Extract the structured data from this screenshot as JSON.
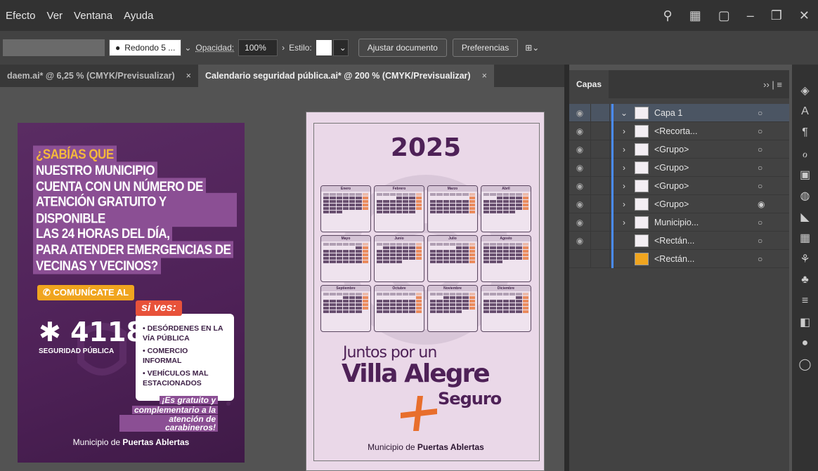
{
  "menu": [
    "Efecto",
    "Ver",
    "Ventana",
    "Ayuda"
  ],
  "window_icons": [
    "search-icon",
    "arrange-icon",
    "screen-mode-icon",
    "minimize-icon",
    "restore-icon",
    "close-icon"
  ],
  "control_bar": {
    "brush": "Redondo 5 ...",
    "opacity_label": "Opacidad:",
    "opacity_value": "100%",
    "style_label": "Estilo:",
    "adjust_button": "Ajustar documento",
    "prefs_button": "Preferencias"
  },
  "tabs": [
    {
      "label": "daem.ai* @ 6,25 % (CMYK/Previsualizar)",
      "close": "×"
    },
    {
      "label": "Calendario seguridad pública.ai* @ 200 % (CMYK/Previsualizar)",
      "close": "×"
    }
  ],
  "poster_left": {
    "lines": [
      "¿SABÍAS QUE",
      "NUESTRO MUNICIPIO",
      "CUENTA CON UN NÚMERO DE",
      "ATENCIÓN GRATUITO Y DISPONIBLE",
      "LAS 24 HORAS DEL DÍA,",
      "PARA ATENDER EMERGENCIAS DE",
      "VECINAS Y VECINOS?"
    ],
    "call": "COMUNÍCATE AL",
    "number": "✱ 4118",
    "number_sub": "SEGURIDAD PÚBLICA",
    "si_ves": "si ves:",
    "items": [
      "• DESÓRDENES EN LA VÍA PÚBLICA",
      "• COMERCIO INFORMAL",
      "• VEHÍCULOS MAL ESTACIONADOS"
    ],
    "free": [
      "¡Es gratuito y",
      "complementario a la",
      "atención de carabineros!"
    ],
    "footer_pre": "Municipio de ",
    "footer_bold": "Puertas Ablertas"
  },
  "poster_calendar": {
    "year": "2025",
    "months": [
      "Enero",
      "Febrero",
      "Marzo",
      "Abril",
      "Mayo",
      "Junio",
      "Julio",
      "Agosto",
      "Septiembre",
      "Octubre",
      "Noviembre",
      "Diciembre"
    ],
    "slogan1": "Juntos por un",
    "slogan2": "Villa Alegre",
    "slogan3": "Seguro",
    "footer_pre": "Municipio de ",
    "footer_bold": "Puertas Ablertas"
  },
  "layers_panel": {
    "tab": "Capas",
    "menu": "›› | ≡",
    "layers": [
      {
        "name": "Capa 1",
        "visible": true,
        "expand": "⌄",
        "selected": true,
        "target": "○"
      },
      {
        "name": "<Recorta...",
        "visible": true,
        "expand": "›",
        "target": "○"
      },
      {
        "name": "<Grupo>",
        "visible": true,
        "expand": "›",
        "target": "○"
      },
      {
        "name": "<Grupo>",
        "visible": true,
        "expand": "›",
        "target": "○"
      },
      {
        "name": "<Grupo>",
        "visible": true,
        "expand": "›",
        "target": "○"
      },
      {
        "name": "<Grupo>",
        "visible": true,
        "expand": "›",
        "target": "◉"
      },
      {
        "name": "Municipio...",
        "visible": true,
        "expand": "›",
        "target": "○"
      },
      {
        "name": "<Rectán...",
        "visible": true,
        "expand": "",
        "target": "○"
      },
      {
        "name": "<Rectán...",
        "visible": false,
        "expand": "",
        "target": "○"
      }
    ]
  },
  "tool_icons": [
    "layers-icon",
    "character-icon",
    "paragraph-icon",
    "glyphs-icon",
    "artboards-icon",
    "color-icon",
    "gradient-icon",
    "libraries-icon",
    "brushes-icon",
    "symbols-icon",
    "align-icon",
    "transparency-icon",
    "appearance-icon",
    "stroke-icon"
  ],
  "colors": {
    "accent": "#4a8cff",
    "purple": "#4e2157",
    "orange": "#e86e2c",
    "yellow": "#f4b93b"
  }
}
